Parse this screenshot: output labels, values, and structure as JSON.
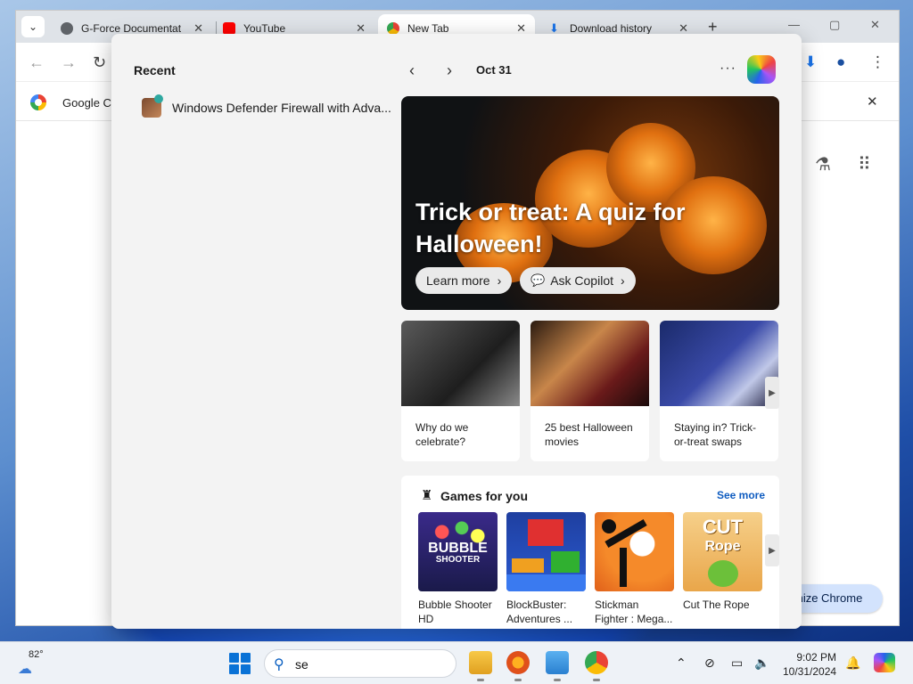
{
  "browser": {
    "tabs": [
      {
        "label": "G-Force Documentat",
        "icon": "globe-icon"
      },
      {
        "label": "YouTube",
        "icon": "youtube-icon"
      },
      {
        "label": "New Tab",
        "icon": "chrome-icon"
      },
      {
        "label": "Download history",
        "icon": "download-icon"
      }
    ],
    "bookmark_text": "Google Ch",
    "customize_label": "mize Chrome"
  },
  "panel": {
    "recent_title": "Recent",
    "recent_items": [
      {
        "label": "Windows Defender Firewall with Adva..."
      }
    ],
    "date": "Oct 31",
    "hero": {
      "title": "Trick or treat: A quiz for Halloween!",
      "learn_more": "Learn more",
      "ask_copilot": "Ask Copilot"
    },
    "cards": [
      {
        "text": "Why do we celebrate?"
      },
      {
        "text": "25 best Halloween movies"
      },
      {
        "text": "Staying in? Trick-or-treat swaps"
      }
    ],
    "games": {
      "title": "Games for you",
      "see_more": "See more",
      "items": [
        {
          "label": "Bubble Shooter HD"
        },
        {
          "label": "BlockBuster: Adventures ..."
        },
        {
          "label": "Stickman Fighter : Mega..."
        },
        {
          "label": "Cut The Rope"
        }
      ],
      "bubble_art": "BUBBLE",
      "bubble_art2": "SHOOTER",
      "cut_art": "CUT",
      "rope_art": "Rope"
    }
  },
  "taskbar": {
    "weather_temp": "82°",
    "search_value": "se",
    "time": "9:02 PM",
    "date": "10/31/2024"
  },
  "colors": {
    "accent": "#0a72d6",
    "see_more": "#0f5cc0",
    "panel_bg": "#f3f3f3"
  }
}
